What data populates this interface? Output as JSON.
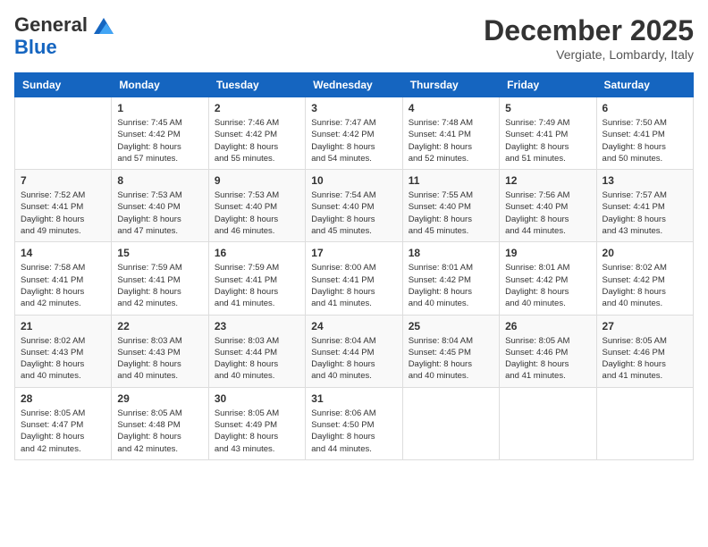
{
  "header": {
    "logo_line1": "General",
    "logo_line2": "Blue",
    "month": "December 2025",
    "location": "Vergiate, Lombardy, Italy"
  },
  "weekdays": [
    "Sunday",
    "Monday",
    "Tuesday",
    "Wednesday",
    "Thursday",
    "Friday",
    "Saturday"
  ],
  "weeks": [
    [
      {
        "day": "",
        "info": ""
      },
      {
        "day": "1",
        "info": "Sunrise: 7:45 AM\nSunset: 4:42 PM\nDaylight: 8 hours\nand 57 minutes."
      },
      {
        "day": "2",
        "info": "Sunrise: 7:46 AM\nSunset: 4:42 PM\nDaylight: 8 hours\nand 55 minutes."
      },
      {
        "day": "3",
        "info": "Sunrise: 7:47 AM\nSunset: 4:42 PM\nDaylight: 8 hours\nand 54 minutes."
      },
      {
        "day": "4",
        "info": "Sunrise: 7:48 AM\nSunset: 4:41 PM\nDaylight: 8 hours\nand 52 minutes."
      },
      {
        "day": "5",
        "info": "Sunrise: 7:49 AM\nSunset: 4:41 PM\nDaylight: 8 hours\nand 51 minutes."
      },
      {
        "day": "6",
        "info": "Sunrise: 7:50 AM\nSunset: 4:41 PM\nDaylight: 8 hours\nand 50 minutes."
      }
    ],
    [
      {
        "day": "7",
        "info": "Sunrise: 7:52 AM\nSunset: 4:41 PM\nDaylight: 8 hours\nand 49 minutes."
      },
      {
        "day": "8",
        "info": "Sunrise: 7:53 AM\nSunset: 4:40 PM\nDaylight: 8 hours\nand 47 minutes."
      },
      {
        "day": "9",
        "info": "Sunrise: 7:53 AM\nSunset: 4:40 PM\nDaylight: 8 hours\nand 46 minutes."
      },
      {
        "day": "10",
        "info": "Sunrise: 7:54 AM\nSunset: 4:40 PM\nDaylight: 8 hours\nand 45 minutes."
      },
      {
        "day": "11",
        "info": "Sunrise: 7:55 AM\nSunset: 4:40 PM\nDaylight: 8 hours\nand 45 minutes."
      },
      {
        "day": "12",
        "info": "Sunrise: 7:56 AM\nSunset: 4:40 PM\nDaylight: 8 hours\nand 44 minutes."
      },
      {
        "day": "13",
        "info": "Sunrise: 7:57 AM\nSunset: 4:41 PM\nDaylight: 8 hours\nand 43 minutes."
      }
    ],
    [
      {
        "day": "14",
        "info": "Sunrise: 7:58 AM\nSunset: 4:41 PM\nDaylight: 8 hours\nand 42 minutes."
      },
      {
        "day": "15",
        "info": "Sunrise: 7:59 AM\nSunset: 4:41 PM\nDaylight: 8 hours\nand 42 minutes."
      },
      {
        "day": "16",
        "info": "Sunrise: 7:59 AM\nSunset: 4:41 PM\nDaylight: 8 hours\nand 41 minutes."
      },
      {
        "day": "17",
        "info": "Sunrise: 8:00 AM\nSunset: 4:41 PM\nDaylight: 8 hours\nand 41 minutes."
      },
      {
        "day": "18",
        "info": "Sunrise: 8:01 AM\nSunset: 4:42 PM\nDaylight: 8 hours\nand 40 minutes."
      },
      {
        "day": "19",
        "info": "Sunrise: 8:01 AM\nSunset: 4:42 PM\nDaylight: 8 hours\nand 40 minutes."
      },
      {
        "day": "20",
        "info": "Sunrise: 8:02 AM\nSunset: 4:42 PM\nDaylight: 8 hours\nand 40 minutes."
      }
    ],
    [
      {
        "day": "21",
        "info": "Sunrise: 8:02 AM\nSunset: 4:43 PM\nDaylight: 8 hours\nand 40 minutes."
      },
      {
        "day": "22",
        "info": "Sunrise: 8:03 AM\nSunset: 4:43 PM\nDaylight: 8 hours\nand 40 minutes."
      },
      {
        "day": "23",
        "info": "Sunrise: 8:03 AM\nSunset: 4:44 PM\nDaylight: 8 hours\nand 40 minutes."
      },
      {
        "day": "24",
        "info": "Sunrise: 8:04 AM\nSunset: 4:44 PM\nDaylight: 8 hours\nand 40 minutes."
      },
      {
        "day": "25",
        "info": "Sunrise: 8:04 AM\nSunset: 4:45 PM\nDaylight: 8 hours\nand 40 minutes."
      },
      {
        "day": "26",
        "info": "Sunrise: 8:05 AM\nSunset: 4:46 PM\nDaylight: 8 hours\nand 41 minutes."
      },
      {
        "day": "27",
        "info": "Sunrise: 8:05 AM\nSunset: 4:46 PM\nDaylight: 8 hours\nand 41 minutes."
      }
    ],
    [
      {
        "day": "28",
        "info": "Sunrise: 8:05 AM\nSunset: 4:47 PM\nDaylight: 8 hours\nand 42 minutes."
      },
      {
        "day": "29",
        "info": "Sunrise: 8:05 AM\nSunset: 4:48 PM\nDaylight: 8 hours\nand 42 minutes."
      },
      {
        "day": "30",
        "info": "Sunrise: 8:05 AM\nSunset: 4:49 PM\nDaylight: 8 hours\nand 43 minutes."
      },
      {
        "day": "31",
        "info": "Sunrise: 8:06 AM\nSunset: 4:50 PM\nDaylight: 8 hours\nand 44 minutes."
      },
      {
        "day": "",
        "info": ""
      },
      {
        "day": "",
        "info": ""
      },
      {
        "day": "",
        "info": ""
      }
    ]
  ]
}
